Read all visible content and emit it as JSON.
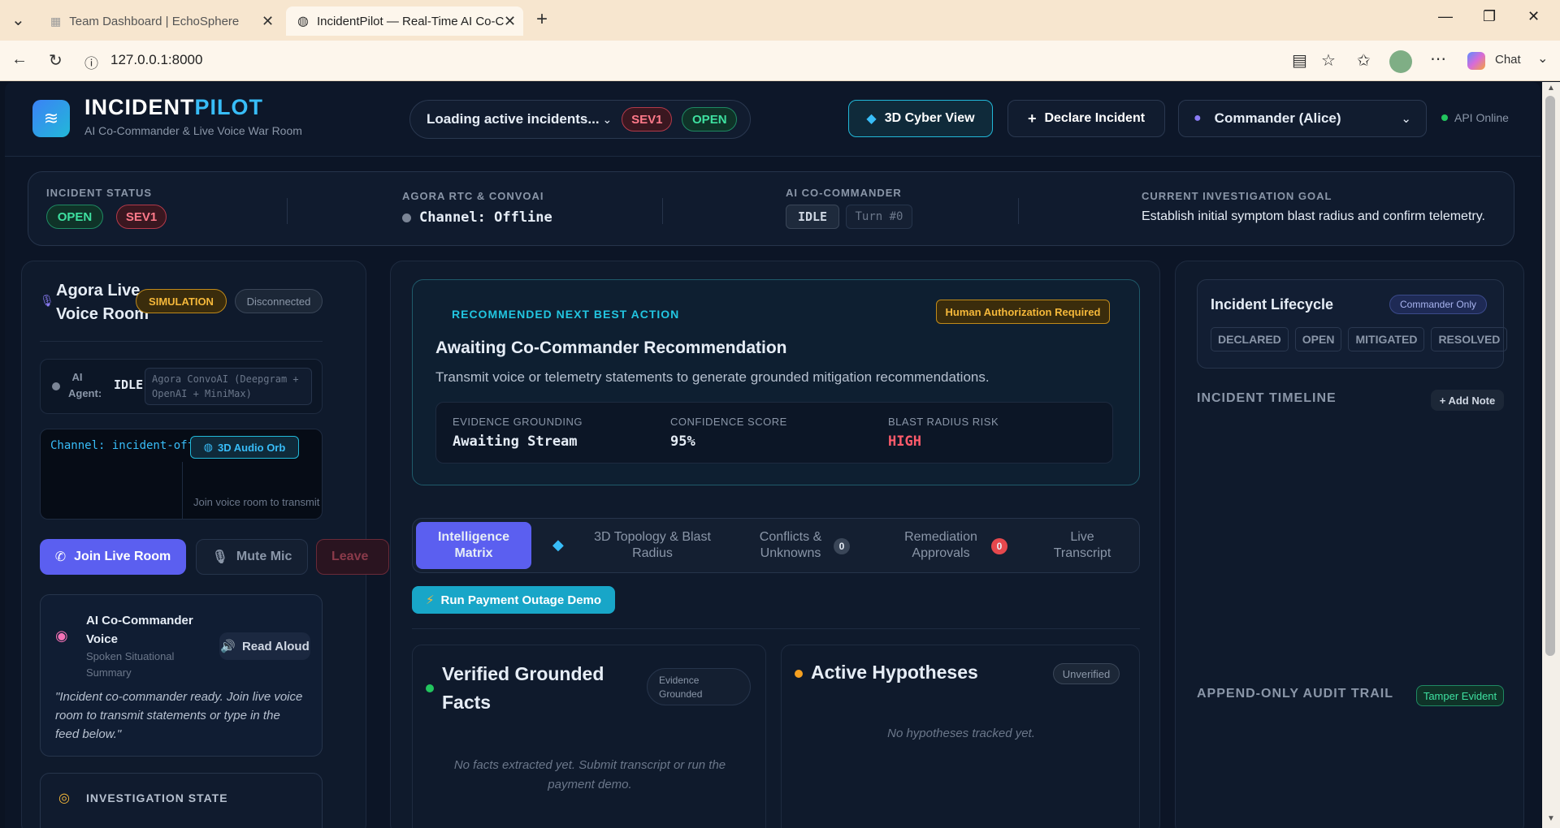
{
  "browser": {
    "tabs": [
      {
        "title": "Team Dashboard | EchoSphere",
        "icon": "grid-icon"
      },
      {
        "title": "IncidentPilot — Real-Time AI Co-C",
        "icon": "globe-icon"
      }
    ],
    "url": "127.0.0.1:8000",
    "chat_label": "Chat"
  },
  "header": {
    "brand_a": "INCIDENT",
    "brand_b": "PILOT",
    "subtitle": "AI Co-Commander & Live Voice War Room",
    "incident_select": "Loading active incidents...",
    "sev_badge": "SEV1",
    "open_badge": "OPEN",
    "cyber_view": "3D Cyber View",
    "declare": "Declare Incident",
    "commander": "Commander (Alice)",
    "api_status": "API Online"
  },
  "status_bar": {
    "incident_status_label": "INCIDENT STATUS",
    "open": "OPEN",
    "sev": "SEV1",
    "agora_label": "AGORA RTC & CONVOAI",
    "channel": "Channel: Offline",
    "ai_label": "AI CO-COMMANDER",
    "ai_state": "IDLE",
    "turn": "Turn #0",
    "goal_label": "CURRENT INVESTIGATION GOAL",
    "goal": "Establish initial symptom blast radius and confirm telemetry."
  },
  "voice_room": {
    "title_1": "Agora Live",
    "title_2": "Voice Room",
    "simulation": "SIMULATION",
    "disconnected": "Disconnected",
    "ai_agent_1": "AI",
    "ai_agent_2": "Agent:",
    "ai_agent_state": "IDLE",
    "agent_stack_1": "Agora ConvoAI (Deepgram +",
    "agent_stack_2": "OpenAI + MiniMax)",
    "channel_text": "Channel: incident-offline",
    "audio_orb": "3D Audio Orb",
    "join_hint": "Join voice room to transmit",
    "join_btn": "Join Live Room",
    "mute_btn": "Mute Mic",
    "leave_btn": "Leave",
    "voice_title_1": "AI Co-Commander",
    "voice_title_2": "Voice",
    "voice_sub_1": "Spoken Situational",
    "voice_sub_2": "Summary",
    "read_aloud": "Read Aloud",
    "quote_1": "\"Incident co-commander ready. Join live voice",
    "quote_2": "room to transmit statements or type in the",
    "quote_3": "feed below.\"",
    "investigation_state": "INVESTIGATION STATE"
  },
  "recommendation": {
    "label": "RECOMMENDED NEXT BEST ACTION",
    "auth": "Human Authorization Required",
    "title": "Awaiting Co-Commander Recommendation",
    "desc": "Transmit voice or telemetry statements to generate grounded mitigation recommendations.",
    "evidence_label": "EVIDENCE GROUNDING",
    "evidence_value": "Awaiting Stream",
    "confidence_label": "CONFIDENCE SCORE",
    "confidence_value": "95%",
    "blast_label": "BLAST RADIUS RISK",
    "blast_value": "HIGH"
  },
  "tabs": {
    "intel_1": "Intelligence",
    "intel_2": "Matrix",
    "topo_1": "3D Topology & Blast",
    "topo_2": "Radius",
    "conf_1": "Conflicts &",
    "conf_2": "Unknowns",
    "conf_count": "0",
    "rem_1": "Remediation",
    "rem_2": "Approvals",
    "rem_count": "0",
    "live_1": "Live",
    "live_2": "Transcript"
  },
  "demo_btn": "Run Payment Outage Demo",
  "facts": {
    "title_1": "Verified Grounded",
    "title_2": "Facts",
    "badge_1": "Evidence",
    "badge_2": "Grounded",
    "empty_1": "No facts extracted yet. Submit transcript or run the",
    "empty_2": "payment demo."
  },
  "hypotheses": {
    "title": "Active Hypotheses",
    "badge": "Unverified",
    "empty": "No hypotheses tracked yet."
  },
  "lifecycle": {
    "title": "Incident Lifecycle",
    "badge": "Commander Only",
    "stages": [
      "DECLARED",
      "OPEN",
      "MITIGATED",
      "RESOLVED"
    ],
    "timeline_label": "INCIDENT TIMELINE",
    "add_note": "+ Add Note",
    "audit_label": "APPEND-ONLY AUDIT TRAIL",
    "tamper": "Tamper Evident"
  },
  "colors": {
    "accent": "#5b5ff0",
    "cyan": "#22b8d8",
    "green": "#3ee0a0",
    "red": "#ff5b6b",
    "yellow": "#f5b83a"
  }
}
